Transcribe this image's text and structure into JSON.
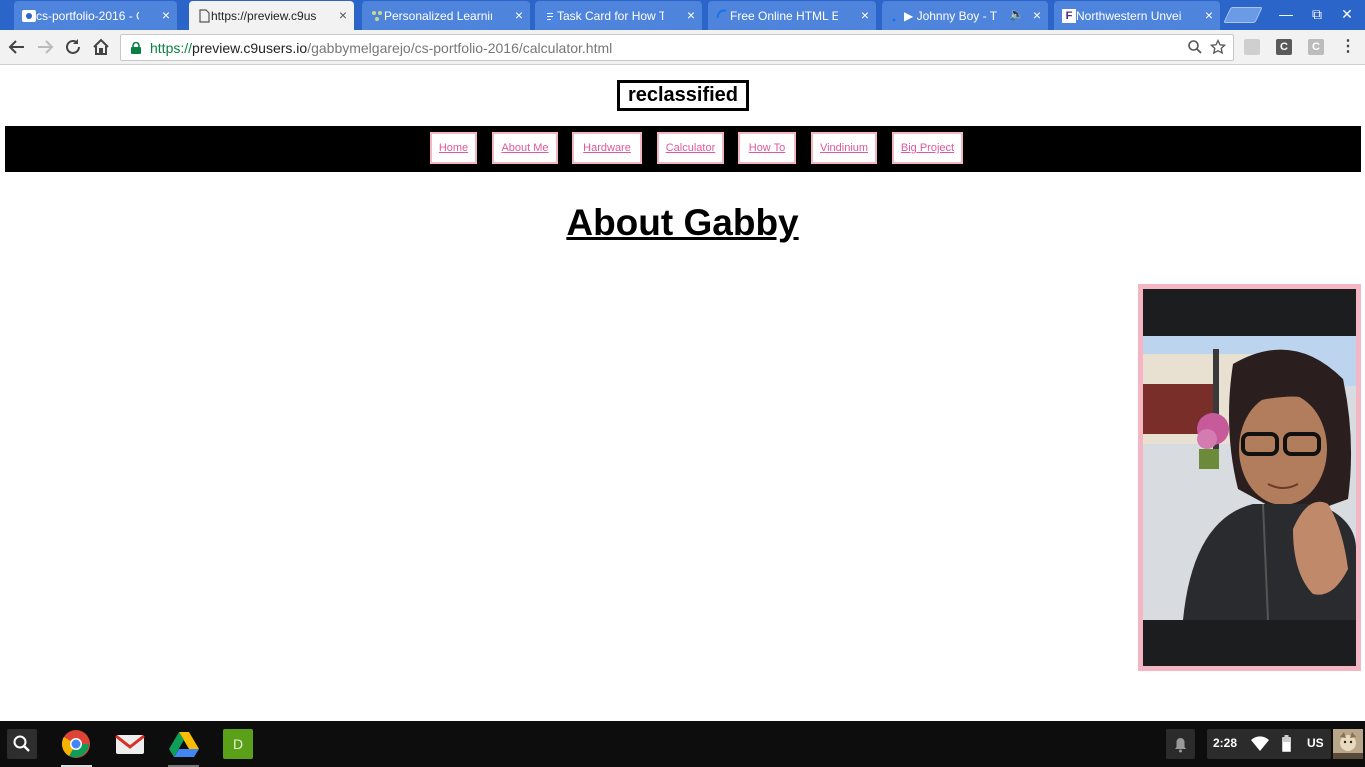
{
  "tabs": [
    {
      "title": "cs-portfolio-2016 - Cl",
      "icon": "eye-icon",
      "active": false
    },
    {
      "title": "https://preview.c9use",
      "icon": "page-icon",
      "active": true
    },
    {
      "title": "Personalized Learnin",
      "icon": "pattern-icon",
      "active": false
    },
    {
      "title": "Task Card for How To",
      "icon": "docs-icon",
      "active": false
    },
    {
      "title": "Free Online HTML Es",
      "icon": "loading-icon",
      "active": false
    },
    {
      "title": "▶ Johnny Boy - T",
      "icon": "loading-icon",
      "active": false,
      "audio": true
    },
    {
      "title": "Northwestern Unveil",
      "icon": "f-icon",
      "active": false
    }
  ],
  "window_controls": {
    "minimize": "—",
    "restore": "⧉",
    "close": "✕"
  },
  "address_bar": {
    "scheme": "https://",
    "host": "preview.c9users.io",
    "path": "/gabbymelgarejo/cs-portfolio-2016/calculator.html"
  },
  "extensions": [
    {
      "name": "extension-1",
      "label": ""
    },
    {
      "name": "extension-c-dark",
      "label": "C"
    },
    {
      "name": "extension-c-light",
      "label": "C"
    }
  ],
  "page": {
    "brand": "reclassified",
    "nav": [
      "Home",
      "About Me",
      "Hardware",
      "Calculator",
      "How To",
      "Vindinium",
      "Big Project"
    ],
    "heading": "About Gabby"
  },
  "shelf": {
    "apps": [
      "chrome-icon",
      "gmail-icon",
      "drive-icon",
      "d-app-icon"
    ],
    "d_app_label": "D",
    "time": "2:28",
    "ime": "US"
  },
  "colors": {
    "accent_pink": "#f4b6c2",
    "link_pink": "#e0589e",
    "tabstrip_blue": "#2c65c9"
  }
}
